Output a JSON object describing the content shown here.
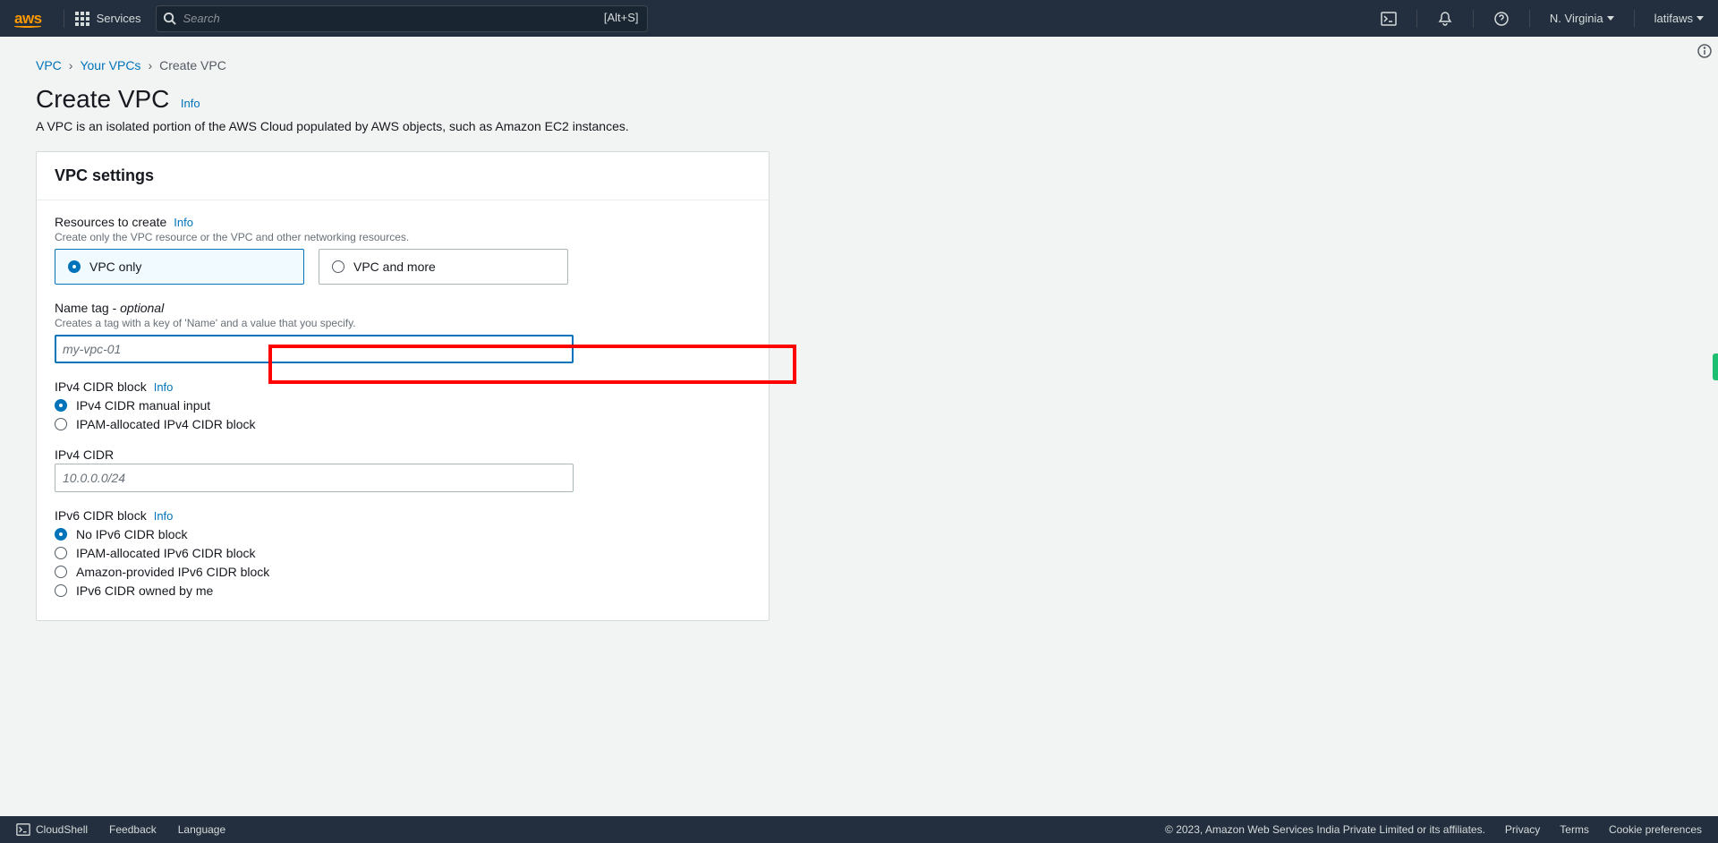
{
  "nav": {
    "logo": "aws",
    "services": "Services",
    "search_placeholder": "Search",
    "search_kbd": "[Alt+S]",
    "region": "N. Virginia",
    "user": "latifaws"
  },
  "breadcrumb": {
    "vpc": "VPC",
    "your_vpcs": "Your VPCs",
    "create_vpc": "Create VPC"
  },
  "page": {
    "title": "Create VPC",
    "info": "Info",
    "subtitle": "A VPC is an isolated portion of the AWS Cloud populated by AWS objects, such as Amazon EC2 instances."
  },
  "panel": {
    "header": "VPC settings",
    "resources": {
      "label": "Resources to create",
      "info": "Info",
      "hint": "Create only the VPC resource or the VPC and other networking resources.",
      "opt1": "VPC only",
      "opt2": "VPC and more"
    },
    "name": {
      "label": "Name tag - ",
      "optional": "optional",
      "hint": "Creates a tag with a key of 'Name' and a value that you specify.",
      "placeholder": "my-vpc-01"
    },
    "ipv4block": {
      "label": "IPv4 CIDR block",
      "info": "Info",
      "opt1": "IPv4 CIDR manual input",
      "opt2": "IPAM-allocated IPv4 CIDR block"
    },
    "ipv4cidr": {
      "label": "IPv4 CIDR",
      "placeholder": "10.0.0.0/24"
    },
    "ipv6block": {
      "label": "IPv6 CIDR block",
      "info": "Info",
      "opt1": "No IPv6 CIDR block",
      "opt2": "IPAM-allocated IPv6 CIDR block",
      "opt3": "Amazon-provided IPv6 CIDR block",
      "opt4": "IPv6 CIDR owned by me"
    }
  },
  "footer": {
    "cloudshell": "CloudShell",
    "feedback": "Feedback",
    "language": "Language",
    "copyright": "© 2023, Amazon Web Services India Private Limited or its affiliates.",
    "privacy": "Privacy",
    "terms": "Terms",
    "cookies": "Cookie preferences"
  }
}
